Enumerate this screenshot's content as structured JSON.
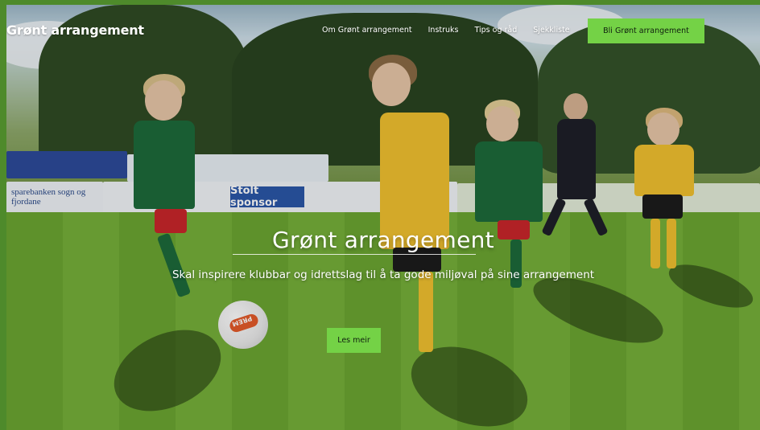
{
  "nav": {
    "brand": "Grønt arrangement",
    "links": [
      "Om Grønt arrangement",
      "Instruks",
      "Tips og råd",
      "Sjekkliste"
    ],
    "cta": "Bli Grønt arrangement"
  },
  "hero": {
    "title": "Grønt arrangement",
    "subtitle": "Skal inspirere klubbar og idrettslag til å ta gode miljøval på sine arrangement",
    "button": "Les meir"
  },
  "background": {
    "signs": [
      "sparebanken sogn og fjordane",
      "Stolt sponsor"
    ],
    "ball_print": "PREM"
  },
  "colors": {
    "accent": "#74d246",
    "frame": "#4e8a2b"
  }
}
